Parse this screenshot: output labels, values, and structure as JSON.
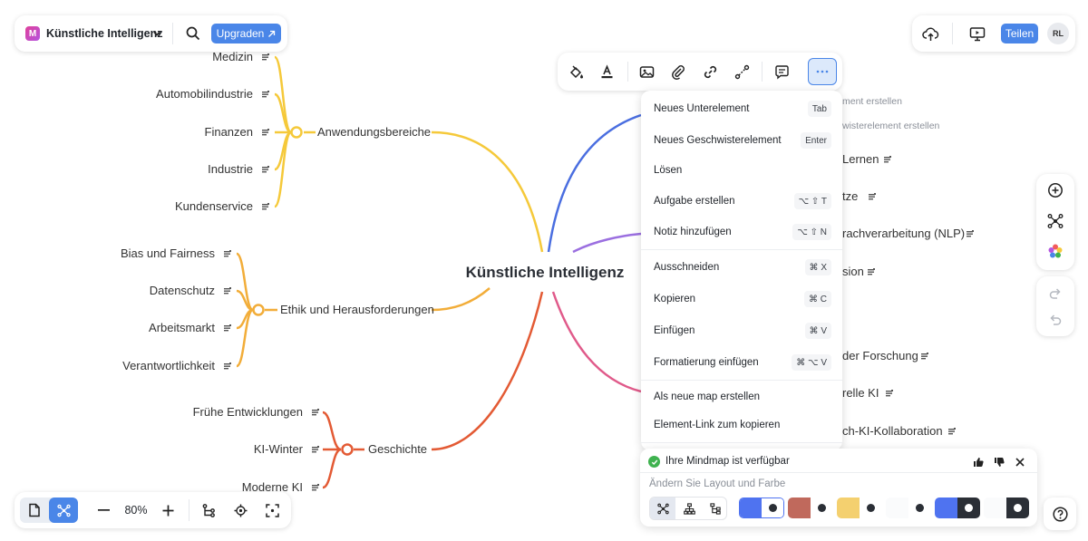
{
  "app": {
    "logo_letter": "M",
    "title": "Künstliche Intelligenz",
    "upgrade_label": "Upgraden",
    "share_label": "Teilen",
    "avatar_initials": "RL",
    "zoom": "80%"
  },
  "mindmap": {
    "center": "Künstliche Intelligenz",
    "left_branches": [
      {
        "label": "Anwendungsbereiche",
        "color": "#f5c93a",
        "children": [
          "Medizin",
          "Automobilindustrie",
          "Finanzen",
          "Industrie",
          "Kundenservice"
        ]
      },
      {
        "label": "Ethik und Herausforderungen",
        "color": "#f2ad39",
        "children": [
          "Bias und Fairness",
          "Datenschutz",
          "Arbeitsmarkt",
          "Verantwortlichkeit"
        ]
      },
      {
        "label": "Geschichte",
        "color": "#e35a34",
        "children": [
          "Frühe Entwicklungen",
          "KI-Winter",
          "Moderne KI"
        ]
      }
    ],
    "right_partial": [
      "Lernen",
      "tze",
      "rachverarbeitung (NLP)",
      "sion",
      "der Forschung",
      "relle KI",
      "ch-KI-Kollaboration"
    ],
    "ghost_hints": [
      "ment erstellen",
      "wisterelement erstellen"
    ],
    "right_colors": [
      "#4a6ee0",
      "#9b6fe0",
      "#e05a8a"
    ]
  },
  "context_menu": {
    "items": [
      {
        "label": "Neues Unterelement",
        "shortcut": "Tab"
      },
      {
        "label": "Neues Geschwisterelement",
        "shortcut": "Enter"
      },
      {
        "label": "Lösen",
        "shortcut": ""
      },
      {
        "label": "Aufgabe erstellen",
        "shortcut": "⌥ ⇧ T"
      },
      {
        "label": "Notiz hinzufügen",
        "shortcut": "⌥ ⇧ N"
      },
      {
        "label": "Ausschneiden",
        "shortcut": "⌘ X"
      },
      {
        "label": "Kopieren",
        "shortcut": "⌘ C"
      },
      {
        "label": "Einfügen",
        "shortcut": "⌘ V"
      },
      {
        "label": "Formatierung einfügen",
        "shortcut": "⌘ ⌥ V"
      },
      {
        "label": "Als neue map erstellen",
        "shortcut": ""
      },
      {
        "label": "Element-Link zum kopieren",
        "shortcut": ""
      }
    ]
  },
  "notification": {
    "title": "Ihre Mindmap ist verfügbar",
    "subtitle": "Ändern Sie Layout und Farbe",
    "swatch_colors": [
      "#4f73f0",
      "#c0695c",
      "#f4d06f",
      "#ffffff",
      "#4f73f0",
      "#2b2f36"
    ]
  },
  "colors": {
    "accent": "#4a86e8",
    "accent_light": "#dce9fb",
    "status_green": "#3fb24f"
  },
  "icons": {
    "toolbar": [
      "paint-fill-icon",
      "text-color-icon",
      "image-icon",
      "attachment-icon",
      "link-icon",
      "connector-icon",
      "comment-icon",
      "more-icon"
    ],
    "right_rail": [
      "add-circle-icon",
      "mindmap-layout-icon",
      "color-palette-icon",
      "redo-icon",
      "undo-icon"
    ],
    "bottom": [
      "page-icon",
      "mindmap-view-icon",
      "zoom-out-icon",
      "zoom-in-icon",
      "tree-structure-icon",
      "focus-icon",
      "fit-screen-icon",
      "help-icon"
    ]
  }
}
